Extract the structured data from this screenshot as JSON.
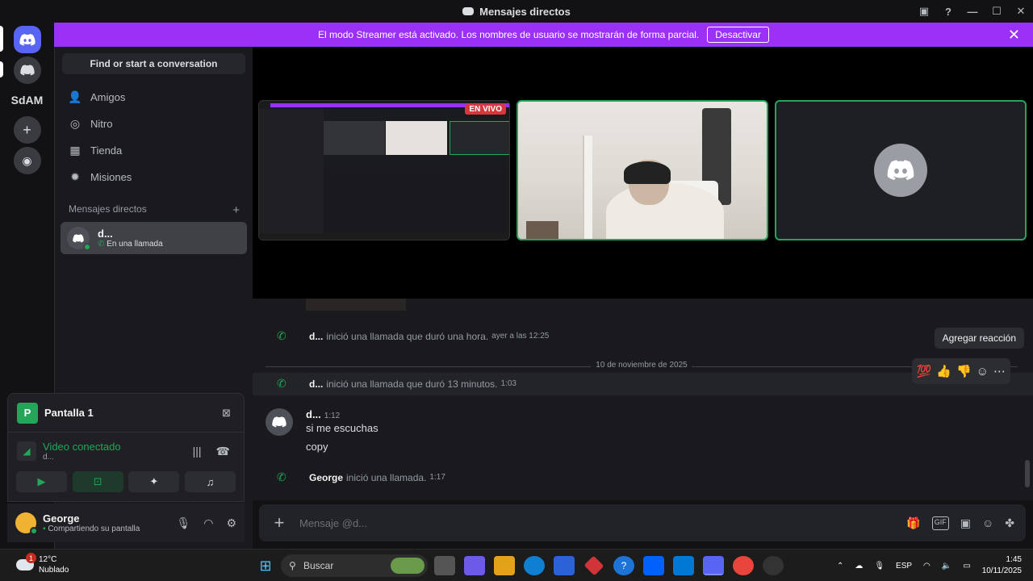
{
  "window": {
    "title": "Mensajes directos"
  },
  "banner": {
    "text": "El modo Streamer está activado. Los nombres de usuario se mostrarán de forma parcial.",
    "button": "Desactivar",
    "color": "#9b30f7"
  },
  "guilds": {
    "server_label": "SdAM"
  },
  "sidebar": {
    "search": "Find or start a conversation",
    "nav": [
      {
        "label": "Amigos",
        "icon": "friends-icon"
      },
      {
        "label": "Nitro",
        "icon": "nitro-icon"
      },
      {
        "label": "Tienda",
        "icon": "shop-icon"
      },
      {
        "label": "Misiones",
        "icon": "quests-icon"
      }
    ],
    "dm_header": "Mensajes directos",
    "dm_item": {
      "name": "d...",
      "status": "En una llamada"
    }
  },
  "voice": {
    "title": "Pantalla 1",
    "badge": "P",
    "status": "Video conectado",
    "channel": "d..."
  },
  "user": {
    "name": "George",
    "status": "Compartiendo su pantalla"
  },
  "stage": {
    "live_badge": "EN VIVO"
  },
  "chat": {
    "call1": {
      "author": "d...",
      "text": "inició una llamada que duró una hora.",
      "time": "ayer a las 12:25"
    },
    "date_divider": "10 de noviembre de 2025",
    "call2": {
      "author": "d...",
      "text": "inició una llamada que duró 13 minutos.",
      "time": "1:03"
    },
    "message": {
      "author": "d...",
      "time": "1:12",
      "lines": [
        "si me escuchas",
        "copy"
      ]
    },
    "call3": {
      "author": "George",
      "text": "inició una llamada.",
      "time": "1:17"
    },
    "reaction_tooltip": "Agregar reacción",
    "quick_reactions": [
      "💯",
      "👍",
      "👎"
    ]
  },
  "composer": {
    "placeholder": "Mensaje @d..."
  },
  "taskbar": {
    "weather": {
      "temp": "12°C",
      "condition": "Nublado",
      "badge": "1"
    },
    "search": "Buscar",
    "lang": "ESP",
    "time": "1:45",
    "date": "10/11/2025"
  }
}
